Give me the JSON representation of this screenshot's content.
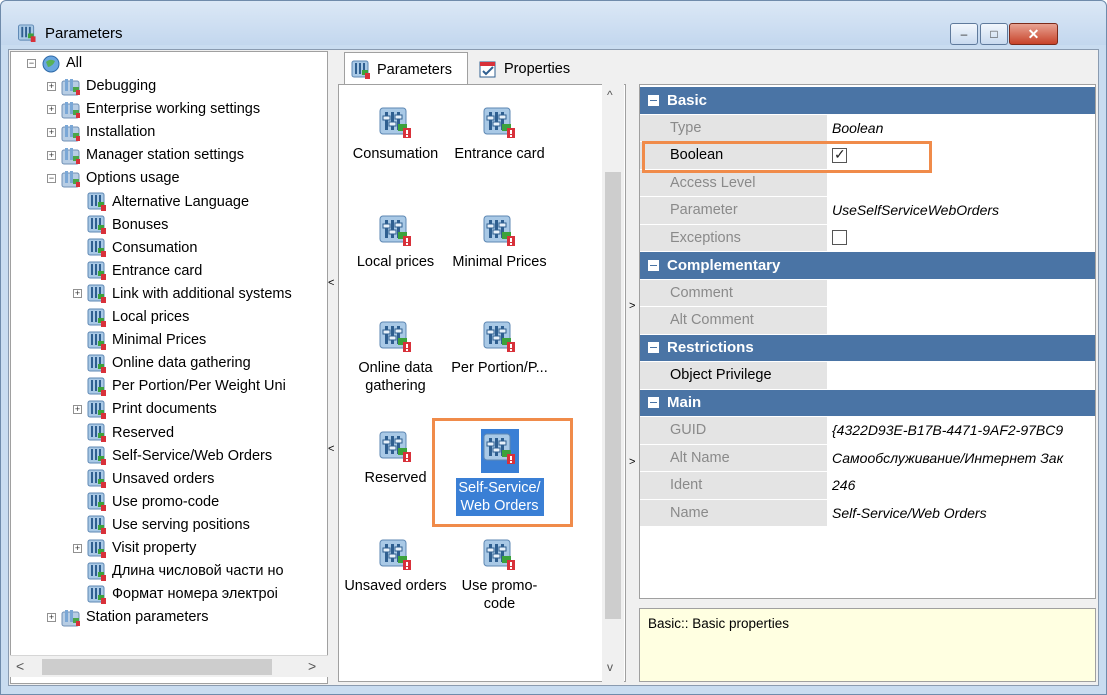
{
  "window": {
    "title": "Parameters",
    "controls": {
      "minimize": "–",
      "maximize": "□",
      "close": "✕"
    }
  },
  "tree": {
    "root": {
      "label": "All",
      "expander": "−"
    },
    "items": [
      {
        "label": "Debugging",
        "expander": "+"
      },
      {
        "label": "Enterprise working settings",
        "expander": "+"
      },
      {
        "label": "Installation",
        "expander": "+"
      },
      {
        "label": "Manager station settings",
        "expander": "+"
      },
      {
        "label": "Options usage",
        "expander": "−"
      },
      {
        "label": "Alternative Language"
      },
      {
        "label": "Bonuses"
      },
      {
        "label": "Consumation"
      },
      {
        "label": "Entrance card"
      },
      {
        "label": "Link with additional systems",
        "expander": "+"
      },
      {
        "label": "Local prices"
      },
      {
        "label": "Minimal Prices"
      },
      {
        "label": "Online data gathering"
      },
      {
        "label": "Per Portion/Per Weight Uni"
      },
      {
        "label": "Print documents",
        "expander": "+"
      },
      {
        "label": "Reserved"
      },
      {
        "label": "Self-Service/Web Orders"
      },
      {
        "label": "Unsaved orders"
      },
      {
        "label": "Use promo-code"
      },
      {
        "label": "Use serving positions"
      },
      {
        "label": "Visit property",
        "expander": "+"
      },
      {
        "label": "Длина числовой части но"
      },
      {
        "label": "Формат номера электрoi"
      },
      {
        "label": "Station parameters",
        "expander": "+"
      }
    ],
    "scroll": {
      "left": "<",
      "right": ">"
    }
  },
  "splitters": {
    "left": "<",
    "right": ">"
  },
  "tabs": [
    {
      "label": "Parameters",
      "active": true
    },
    {
      "label": "Properties",
      "active": false
    }
  ],
  "icons": [
    {
      "label": "Consumation"
    },
    {
      "label": "Entrance card"
    },
    {
      "label": "Local prices"
    },
    {
      "label": "Minimal Prices"
    },
    {
      "label": "Online data gathering"
    },
    {
      "label": "Per Portion/P..."
    },
    {
      "label": "Reserved"
    },
    {
      "label": "Self-Service/ Web Orders",
      "selected": true
    },
    {
      "label": "Unsaved orders"
    },
    {
      "label": "Use promo-code"
    }
  ],
  "icon_scroll": {
    "up": "^",
    "down": "v"
  },
  "properties": {
    "basic": {
      "header": "Basic",
      "type_name": "Type",
      "type_value": "Boolean",
      "boolean_name": "Boolean",
      "boolean_checked": true,
      "access_name": "Access Level",
      "parameter_name": "Parameter",
      "parameter_value": "UseSelfServiceWebOrders",
      "exceptions_name": "Exceptions",
      "exceptions_checked": false
    },
    "complementary": {
      "header": "Complementary",
      "comment_name": "Comment",
      "altcomment_name": "Alt Comment"
    },
    "restrictions": {
      "header": "Restrictions",
      "privilege_name": "Object Privilege"
    },
    "main": {
      "header": "Main",
      "guid_name": "GUID",
      "guid_value": "{4322D93E-B17B-4471-9AF2-97BC9",
      "altname_name": "Alt Name",
      "altname_value": "Самообслуживание/Интернет Зак",
      "ident_name": "Ident",
      "ident_value": "246",
      "name_name": "Name",
      "name_value": "Self-Service/Web Orders"
    }
  },
  "description": "Basic:: Basic properties",
  "colors": {
    "category_header": "#4a74a5",
    "selection": "#3a7fd5",
    "highlight": "#f08b4a",
    "description_bg": "#ffffe1"
  }
}
